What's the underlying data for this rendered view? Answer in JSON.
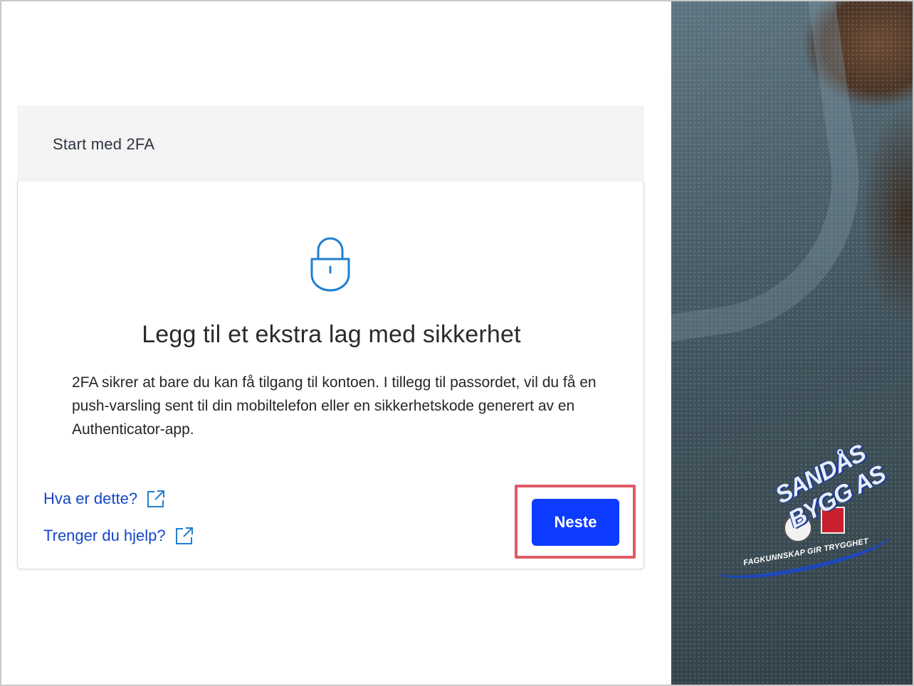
{
  "header": {
    "title": "Start med 2FA"
  },
  "main": {
    "icon": "lock-icon",
    "title": "Legg til et ekstra lag med sikkerhet",
    "description": "2FA sikrer at bare du kan få tilgang til kontoen. I tillegg til passordet, vil du få en push-varsling sent til din mobiltelefon eller en sikkerhetskode generert av en Authenticator-app."
  },
  "links": [
    {
      "label": "Hva er dette?",
      "icon": "external-link-icon"
    },
    {
      "label": "Trenger du hjelp?",
      "icon": "external-link-icon"
    }
  ],
  "actions": {
    "next_label": "Neste"
  },
  "photo": {
    "logo_name": "SANDÅS BYGG AS",
    "logo_slogan": "FAGKUNNSKAP GIR TRYGGHET"
  },
  "colors": {
    "primary": "#0d3bff",
    "link": "#1546c7",
    "icon": "#1f7fd1",
    "highlight": "#e05a67",
    "header_bg": "#f4f4f4"
  }
}
